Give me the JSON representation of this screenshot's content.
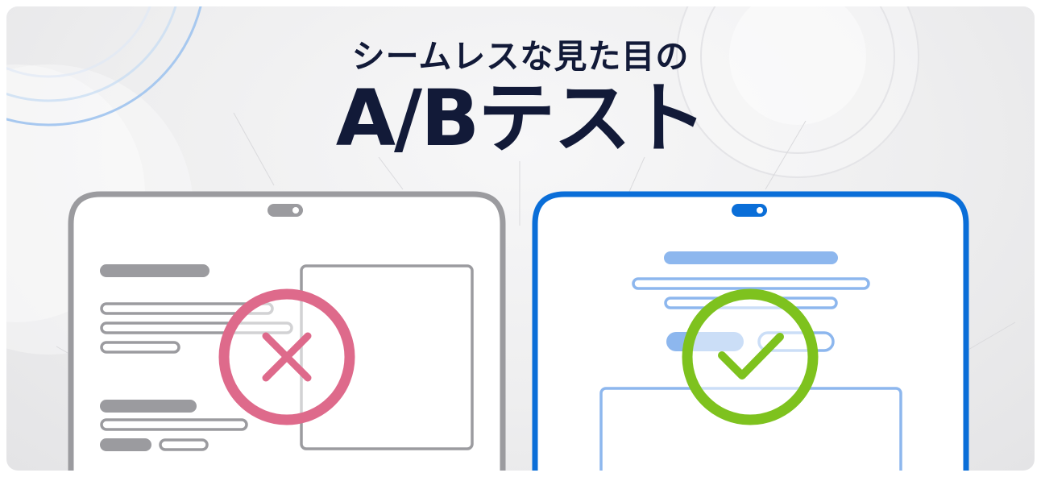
{
  "heading": {
    "subtitle": "シームレスな見た目の",
    "title": "A/Bテスト"
  },
  "variant_a": {
    "result": "rejected",
    "result_icon": "cross-icon",
    "frame_color": "#9b9b9f",
    "mark_color": "#de6a8b"
  },
  "variant_b": {
    "result": "accepted",
    "result_icon": "check-icon",
    "frame_color": "#0a6ed8",
    "mark_color": "#7ec21e",
    "line_color": "#8db7ee"
  },
  "colors": {
    "title": "#121a38",
    "background": "#eeeeef"
  }
}
